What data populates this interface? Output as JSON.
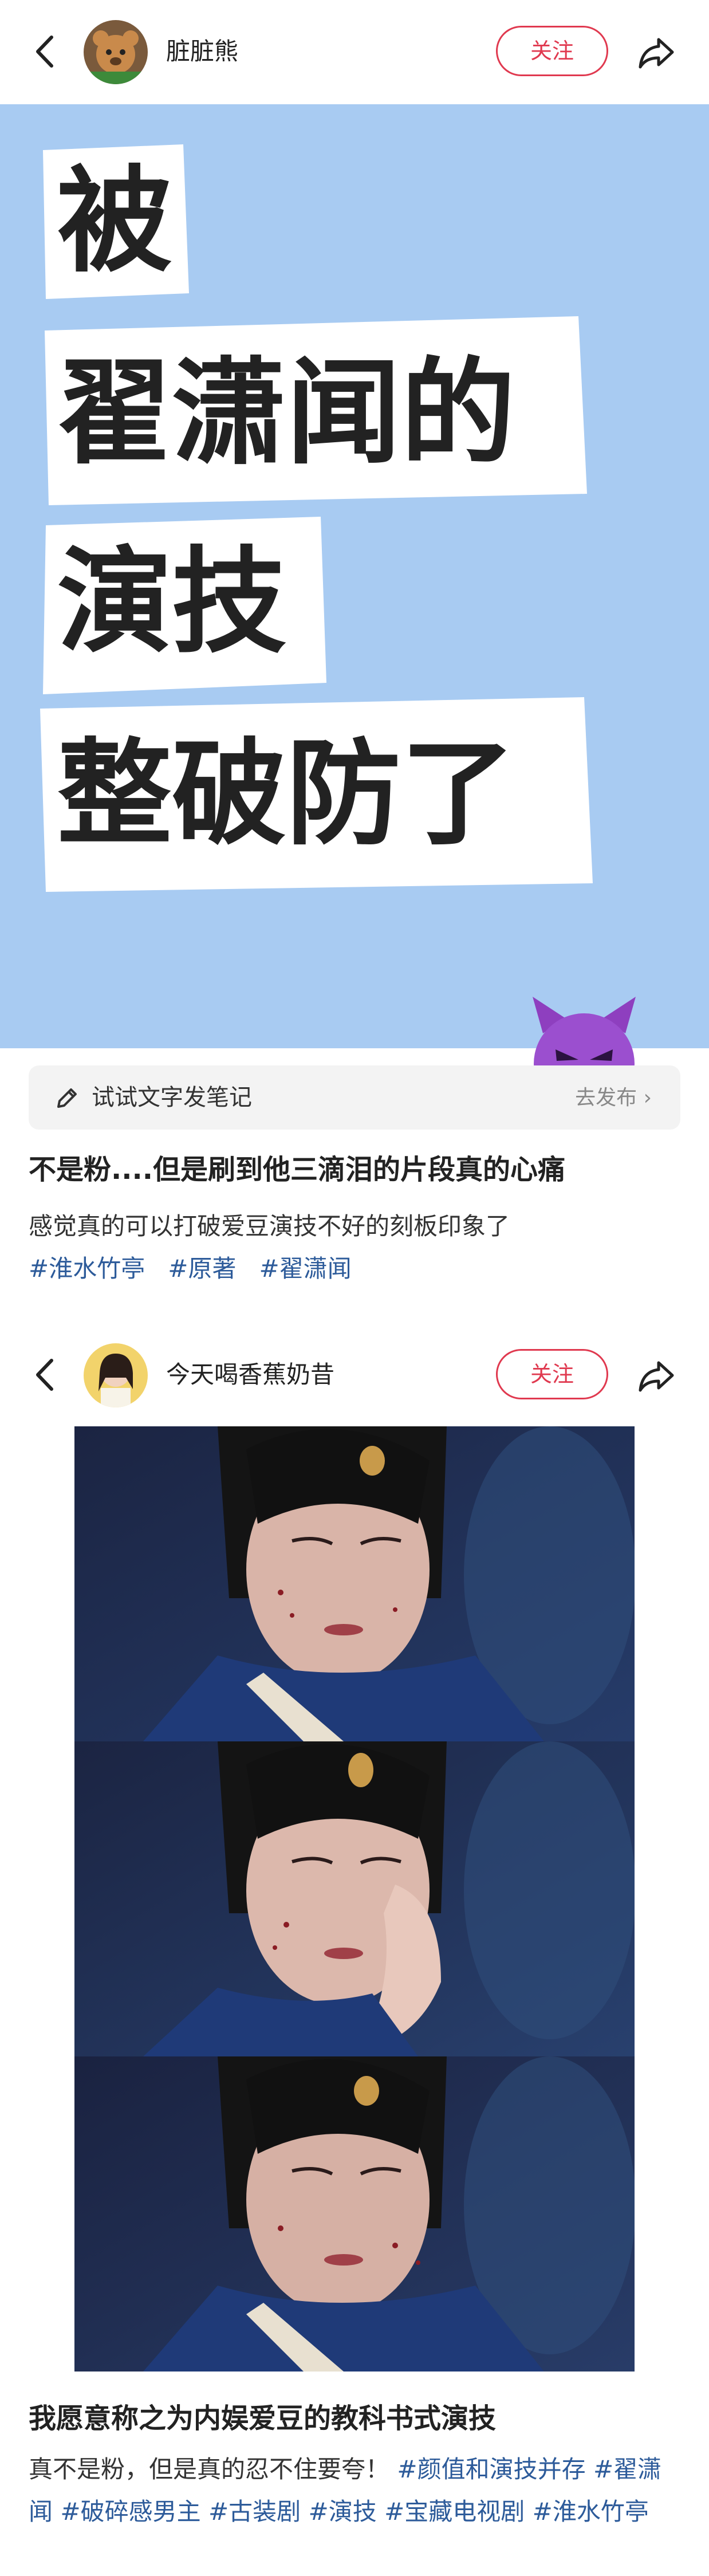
{
  "post1": {
    "username": "脏脏熊",
    "follow_label": "关注",
    "cover_lines": [
      "被",
      "翟潇闻的",
      "演技",
      "整破防了"
    ],
    "tip": {
      "text": "试试文字发笔记",
      "action": "去发布 ›"
    },
    "title": "不是粉....但是刷到他三滴泪的片段真的心痛",
    "body": "感觉真的可以打破爱豆演技不好的刻板印象了",
    "tags": [
      "#淮水竹亭",
      "#原著",
      "#翟潇闻"
    ]
  },
  "post2": {
    "username": "今天喝香蕉奶昔",
    "follow_label": "关注",
    "title": "我愿意称之为内娱爱豆的教科书式演技",
    "body_lead": "真不是粉，但是真的忍不住要夸！",
    "tags": [
      "#颜值和演技并存",
      "#翟潇闻",
      "#破碎感男主",
      "#古装剧",
      "#演技",
      "#宝藏电视剧",
      "#淮水竹亭"
    ]
  },
  "colors": {
    "accent": "#e0394f",
    "tag": "#2d5b9a",
    "cover_bg": "#a8cbf2"
  },
  "icons": [
    "back-arrow-icon",
    "share-icon",
    "pen-icon",
    "devil-emoji-icon",
    "chevron-right-icon"
  ]
}
